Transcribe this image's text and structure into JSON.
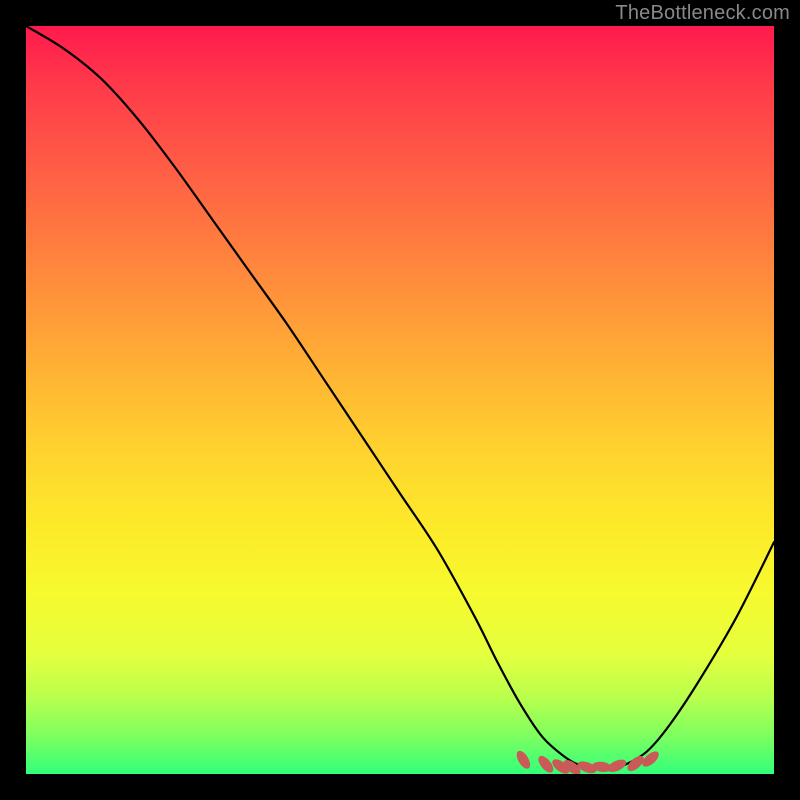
{
  "watermark": "TheBottleneck.com",
  "chart_data": {
    "type": "line",
    "title": "",
    "xlabel": "",
    "ylabel": "",
    "xlim": [
      0,
      100
    ],
    "ylim": [
      0,
      100
    ],
    "series": [
      {
        "name": "curve",
        "x": [
          0,
          5,
          10,
          15,
          20,
          25,
          30,
          35,
          40,
          45,
          50,
          55,
          60,
          63,
          66,
          69,
          72,
          74,
          76,
          78,
          80,
          83,
          86,
          90,
          95,
          100
        ],
        "values": [
          100,
          97,
          93,
          87.5,
          81,
          74,
          67,
          60,
          52.5,
          45,
          37.5,
          30,
          21,
          15,
          9.5,
          5,
          2.3,
          1.2,
          0.7,
          0.7,
          1.2,
          3,
          6.5,
          12.5,
          21,
          31
        ]
      },
      {
        "name": "markers",
        "x": [
          66.5,
          69.5,
          71.5,
          73,
          75,
          77,
          79,
          81.5,
          83.5
        ],
        "values": [
          1.9,
          1.3,
          1.0,
          0.9,
          0.9,
          0.95,
          1.1,
          1.4,
          2.0
        ]
      }
    ],
    "colors": {
      "curve": "#000000",
      "markers": "#c95a58"
    }
  }
}
